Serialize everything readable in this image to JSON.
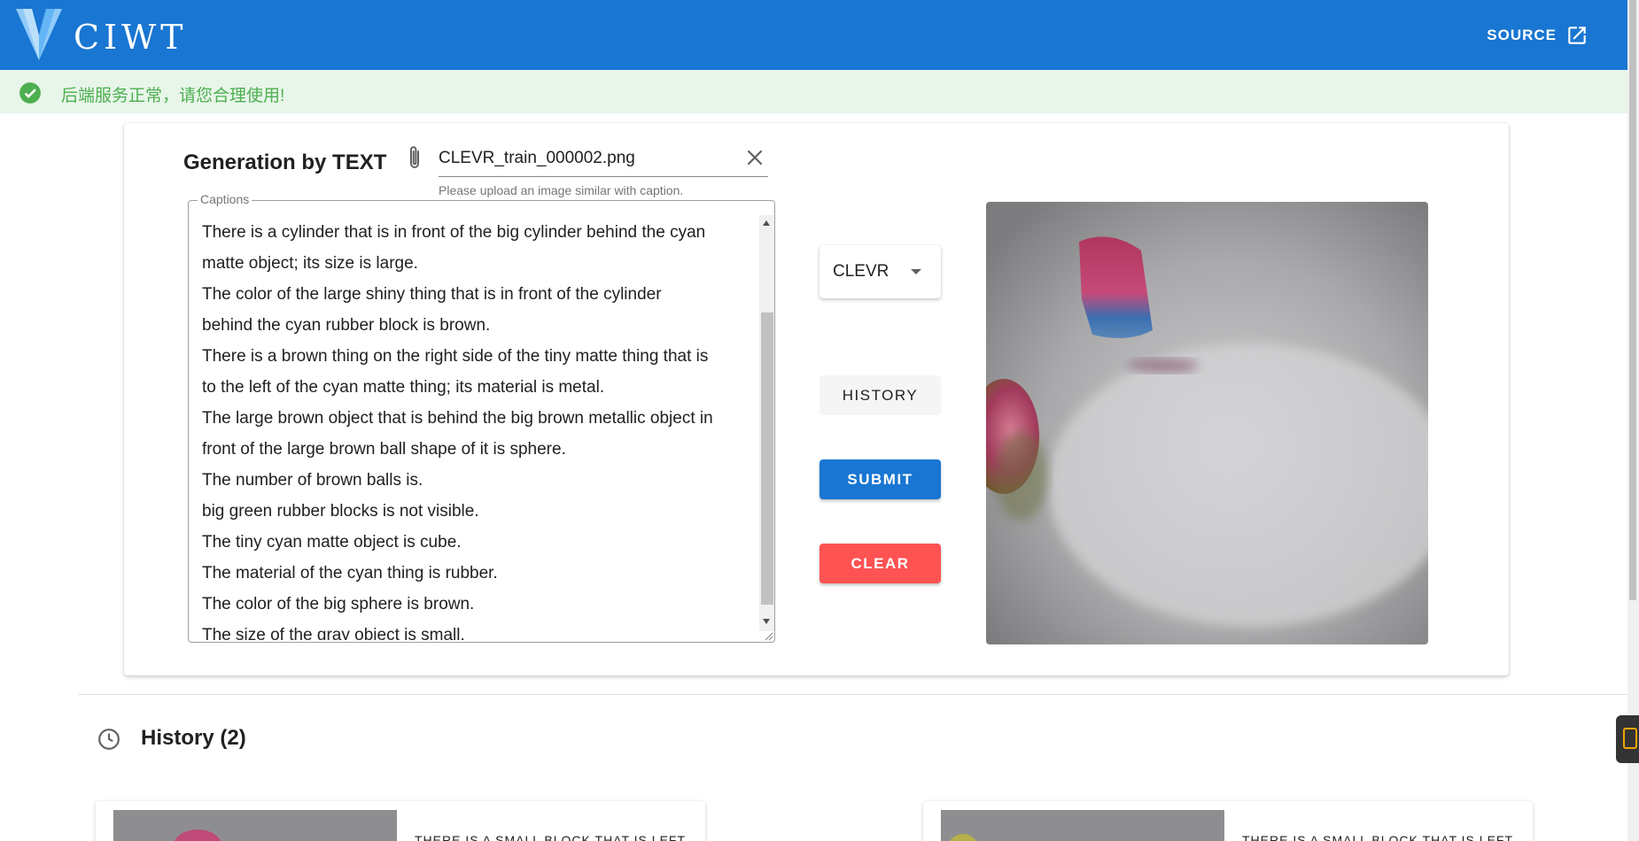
{
  "appbar": {
    "brand": "CIWT",
    "source_label": "SOURCE",
    "color": "#1976d2"
  },
  "alert": {
    "message": "后端服务正常，请您合理使用!",
    "color": "#4caf50"
  },
  "generator": {
    "title": "Generation by TEXT",
    "file_name": "CLEVR_train_000002.png",
    "file_hint": "Please upload an image similar with caption.",
    "captions_label": "Captions",
    "captions": [
      "There is a cylinder that is in front of the big cylinder behind the cyan",
      "matte object; its size is large.",
      "The color of the large shiny thing that is in front of the cylinder",
      "behind the cyan rubber block is brown.",
      "There is a brown thing on the right side of the tiny matte thing that is",
      "to the left of the cyan matte thing; its material is metal.",
      "The large brown object that is behind the big brown metallic object in",
      "front of the large brown ball shape of it is sphere.",
      "The number of brown balls is.",
      "big green rubber blocks is not visible.",
      "The tiny cyan matte object is cube.",
      "The material of the cyan thing is rubber.",
      "The color of the big sphere is brown.",
      "The size of the gray object is small."
    ],
    "dataset_selected": "CLEVR",
    "history_label": "HISTORY",
    "submit_label": "SUBMIT",
    "clear_label": "CLEAR",
    "submit_color": "#1976d2",
    "clear_color": "#ff5252"
  },
  "history": {
    "title": "History (2)",
    "items": [
      {
        "caption": "THERE IS A SMALL BLOCK THAT IS LEFT"
      },
      {
        "caption": "THERE IS A SMALL BLOCK THAT IS LEFT"
      }
    ]
  }
}
